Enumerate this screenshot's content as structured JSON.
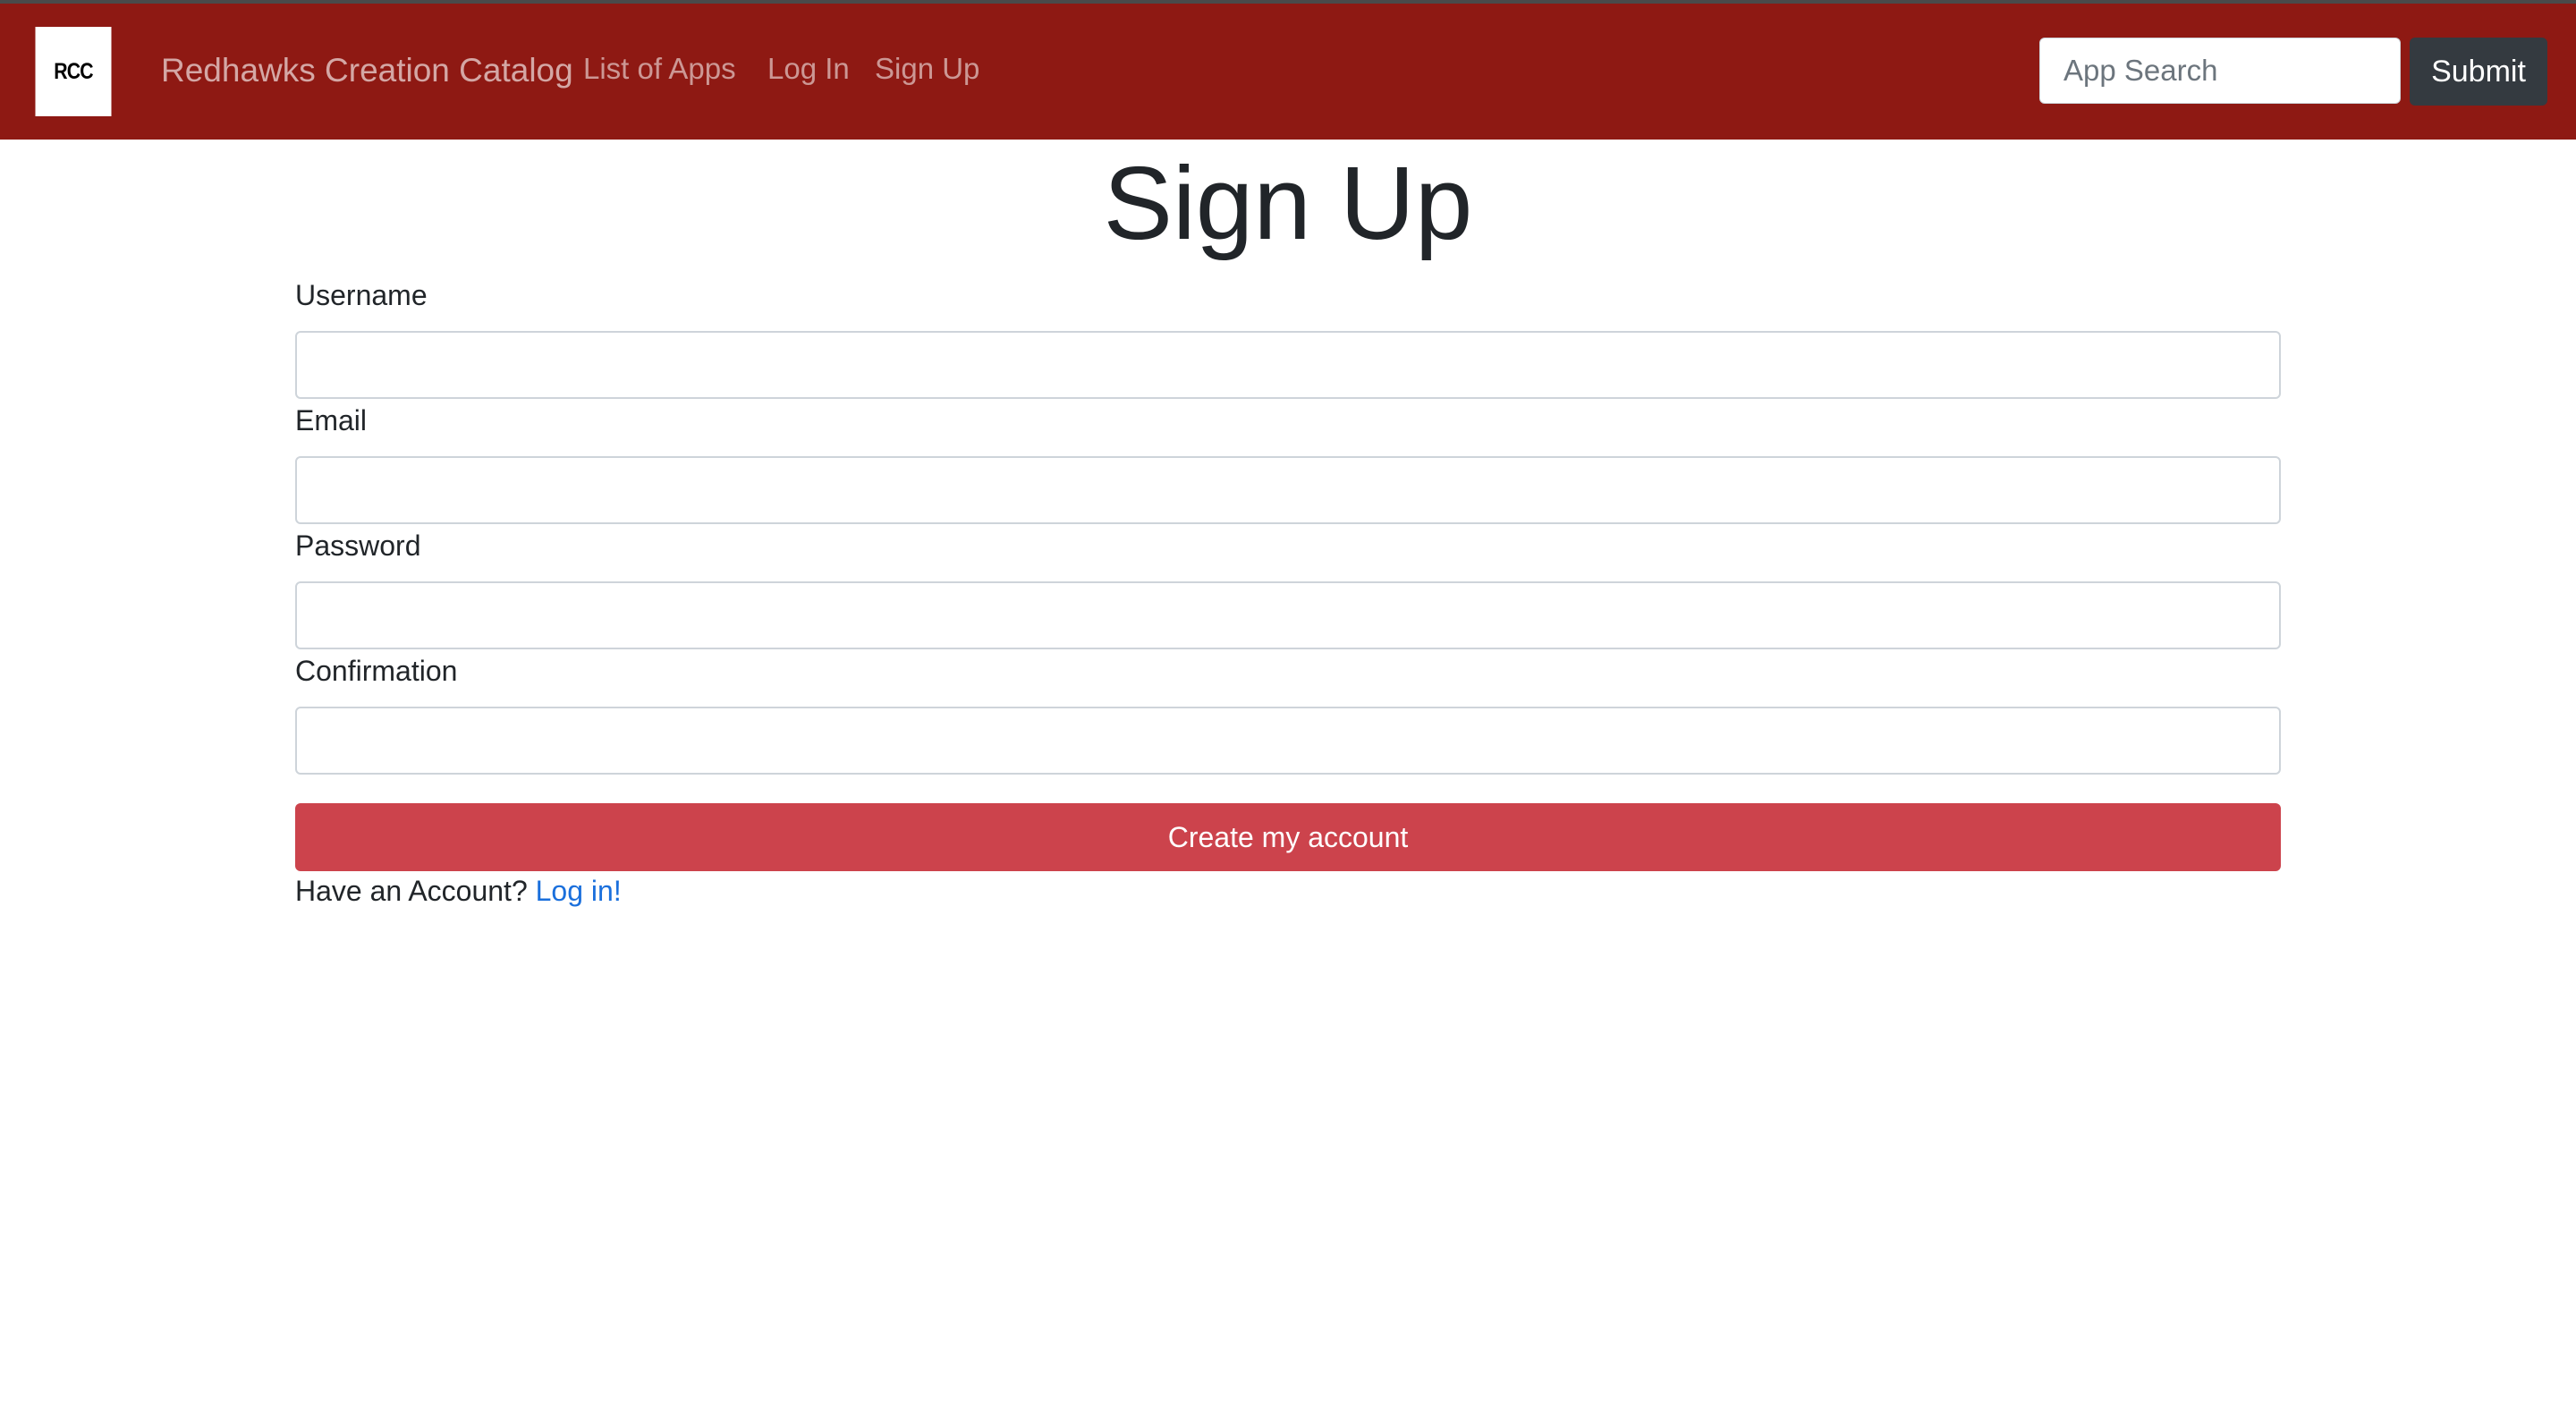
{
  "navbar": {
    "logo_text": "RCC",
    "brand": "Redhawks Creation Catalog",
    "links": [
      "List of Apps",
      "Log In",
      "Sign Up"
    ],
    "search_placeholder": "App Search",
    "submit_label": "Submit",
    "background_color": "#8e1913"
  },
  "page": {
    "title": "Sign Up"
  },
  "form": {
    "fields": [
      {
        "label": "Username",
        "value": ""
      },
      {
        "label": "Email",
        "value": ""
      },
      {
        "label": "Password",
        "value": ""
      },
      {
        "label": "Confirmation",
        "value": ""
      }
    ],
    "submit_label": "Create my account",
    "submit_color": "#cc434c",
    "footer_text": "Have an Account?",
    "footer_link": "Log in!",
    "link_color": "#1a6fdc"
  }
}
